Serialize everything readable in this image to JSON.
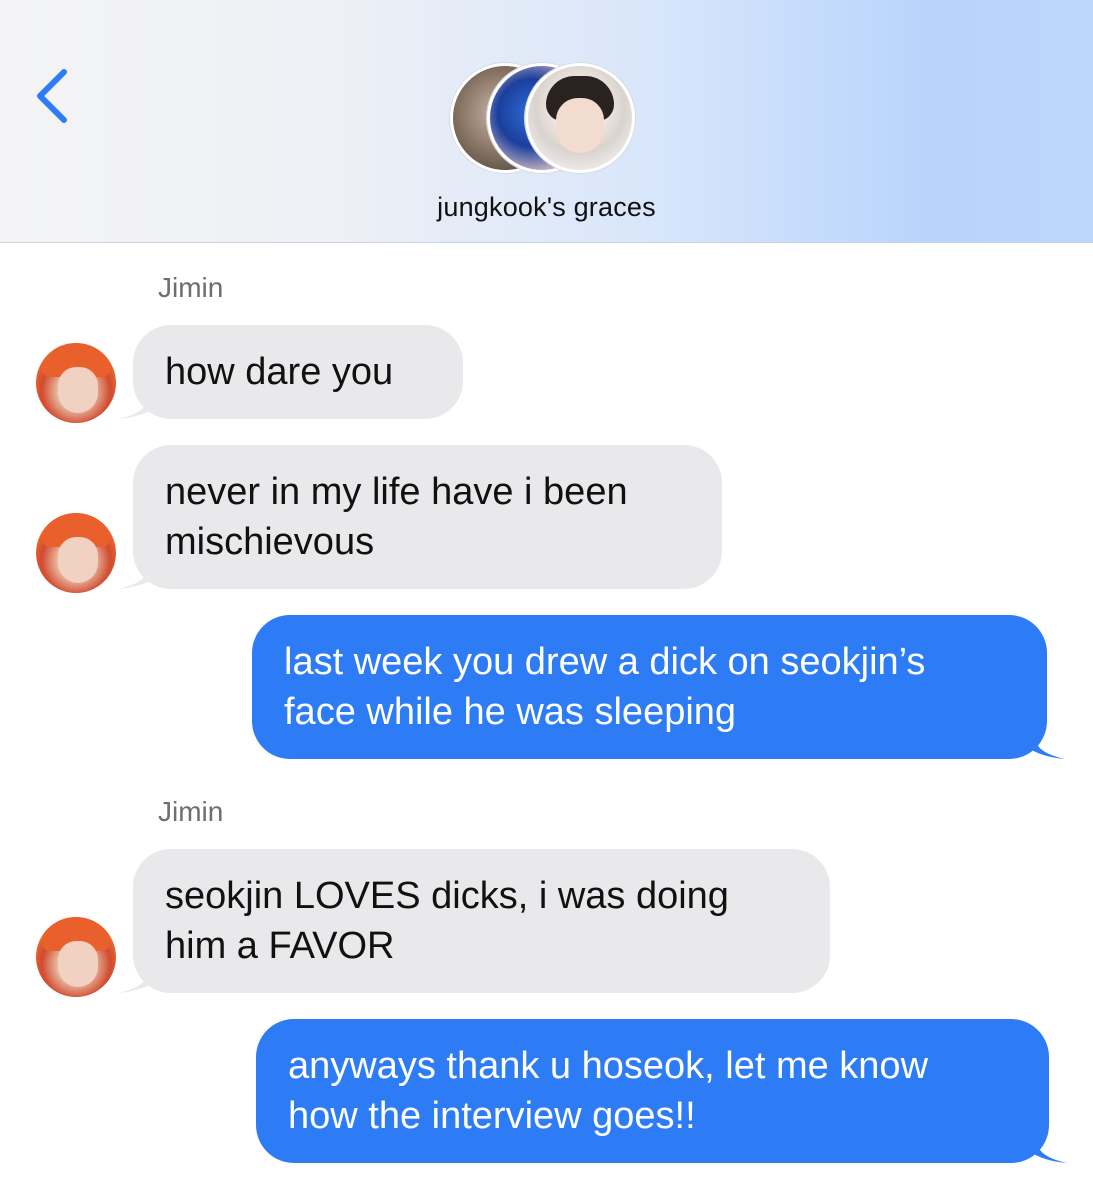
{
  "header": {
    "back_icon": "chevron-left-icon",
    "group_name": "jungkook's graces",
    "accent": "#2d7cf6"
  },
  "colors": {
    "incoming_bubble": "#e9e9eb",
    "outgoing_bubble": "#2d7cf6",
    "sender_label": "#6d6d72"
  },
  "messages": [
    {
      "sender": "Jimin",
      "text": "how dare you"
    },
    {
      "text": "never in my life have i been\nmischievous"
    },
    {
      "text": "last week you drew a dick on seokjin’s\nface while he was sleeping"
    },
    {
      "sender": "Jimin",
      "text": "seokjin LOVES dicks, i was doing\nhim a FAVOR"
    },
    {
      "text": "anyways thank u hoseok, let me know\nhow the interview goes!!"
    }
  ]
}
